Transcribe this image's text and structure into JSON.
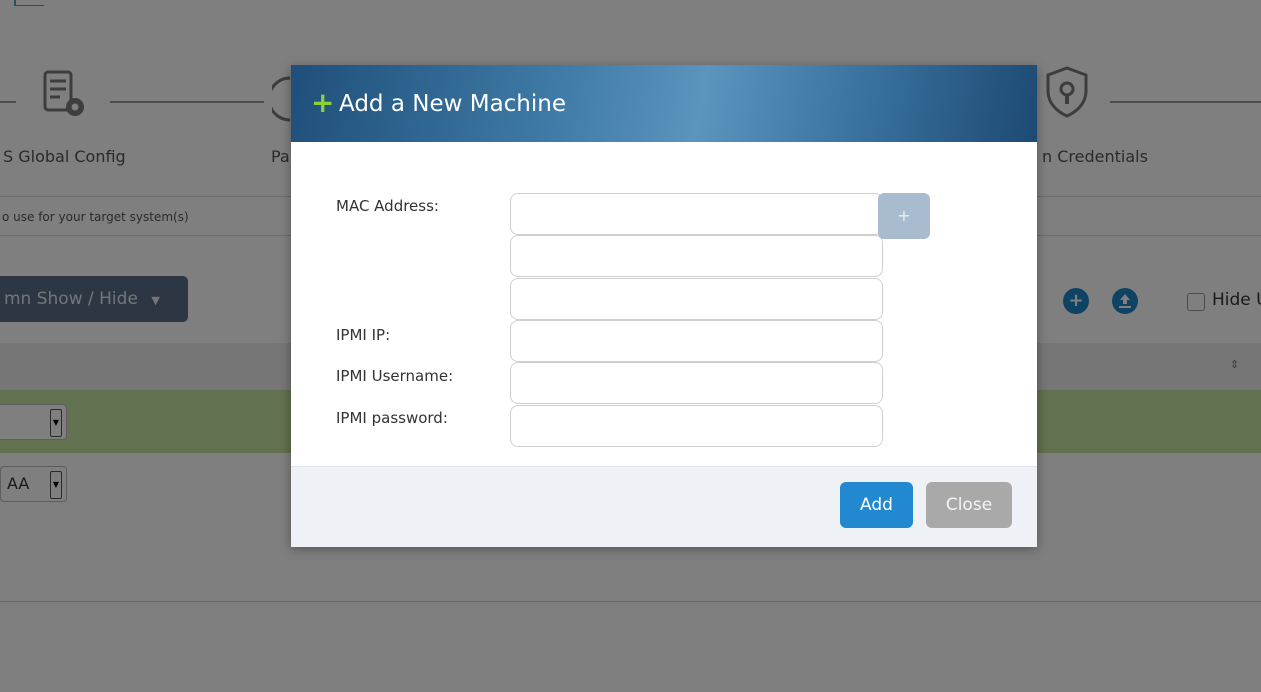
{
  "wizard": {
    "steps": [
      {
        "label": "S Global Config",
        "icon": "server-config-icon"
      },
      {
        "label": "Pa",
        "icon": "partial-step-icon"
      },
      {
        "label": "n Credentials",
        "icon": "shield-lock-icon"
      }
    ]
  },
  "hint": {
    "text": "o use for your target system(s)"
  },
  "toolbar": {
    "column_toggle_label": "mn Show / Hide",
    "add_icon": "plus-circle-icon",
    "upload_icon": "upload-icon",
    "hide_label": "Hide U"
  },
  "table": {
    "rows": [
      {
        "select_value": ""
      },
      {
        "select_value": "AA"
      }
    ]
  },
  "modal": {
    "title": "Add a New Machine",
    "plus_symbol": "+",
    "fields": {
      "mac_label": "MAC Address:",
      "mac_add": "+",
      "ipmi_ip_label": "IPMI IP:",
      "ipmi_user_label": "IPMI Username:",
      "ipmi_pass_label": "IPMI password:"
    },
    "values": {
      "mac1": "",
      "mac2": "",
      "mac3": "",
      "ipmi_ip": "",
      "ipmi_user": "",
      "ipmi_pass": ""
    },
    "buttons": {
      "add": "Add",
      "close": "Close"
    }
  },
  "colors": {
    "primary": "#2289d0",
    "header_dark": "#1f4f7a",
    "success_row": "#c5e2a0",
    "plus_green": "#8bd13a"
  }
}
